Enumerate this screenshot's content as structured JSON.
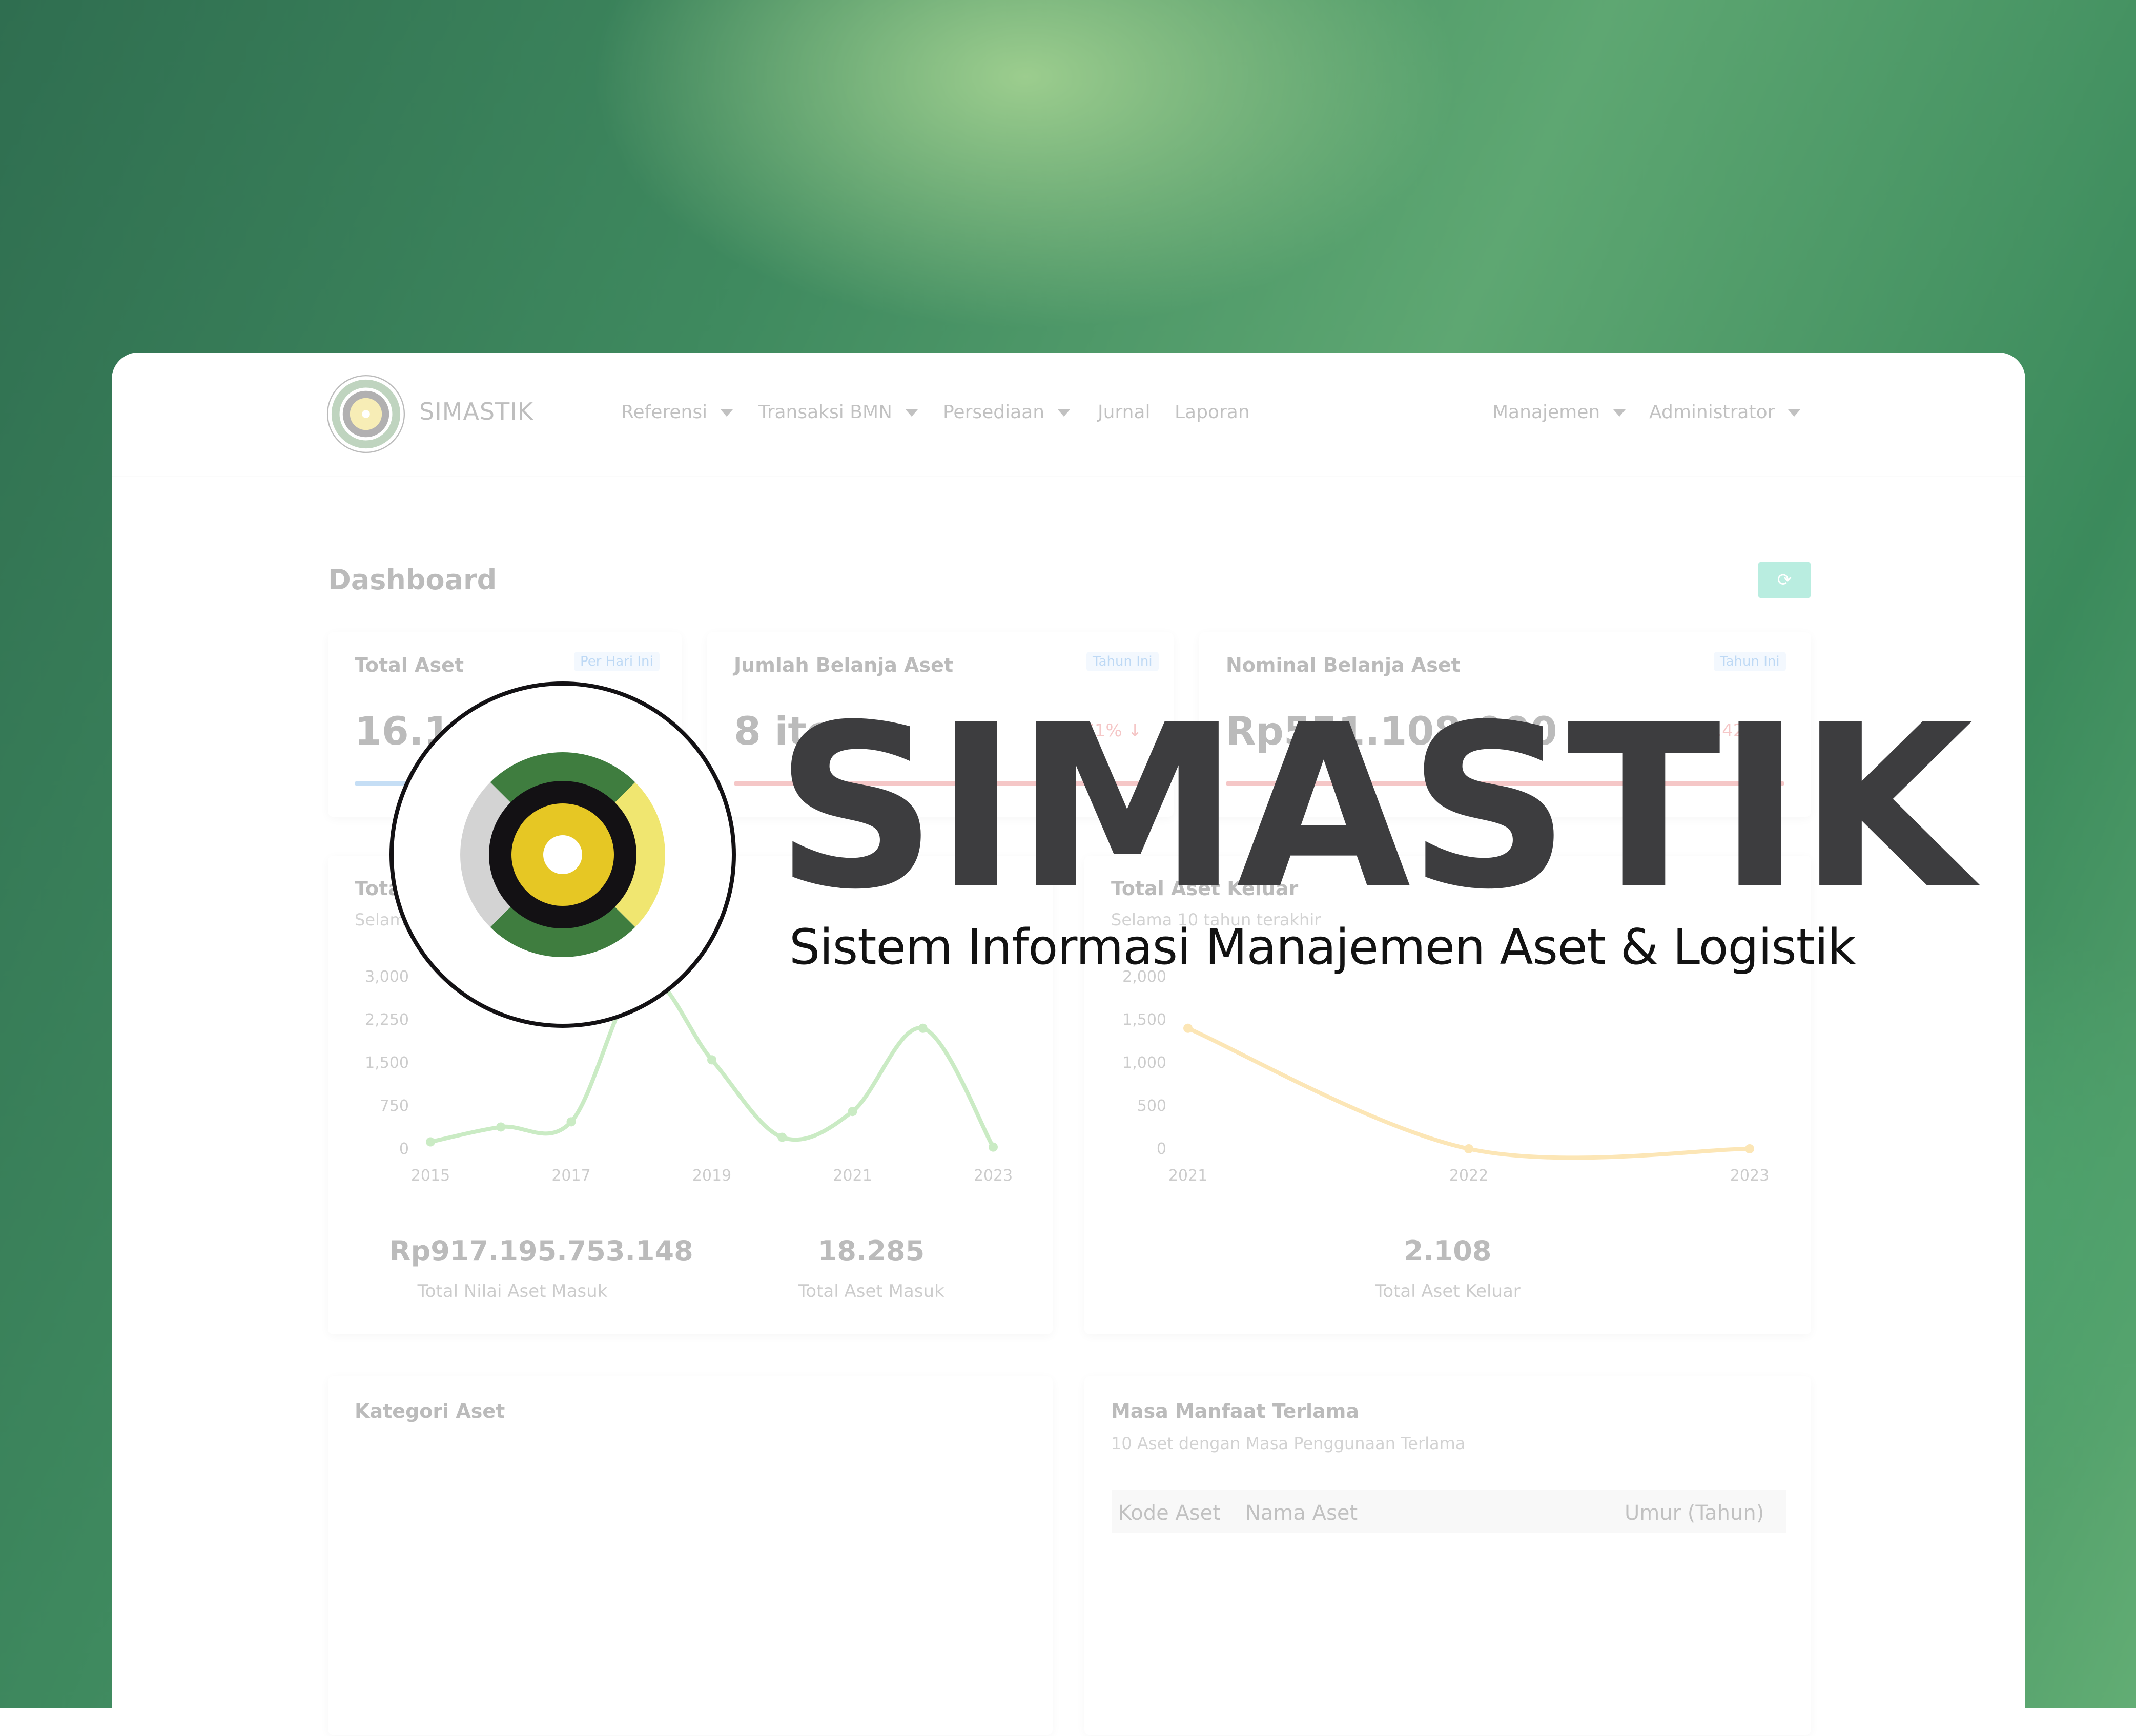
{
  "app": {
    "brand": "SIMASTIK",
    "tagline": "Sistem Informasi Manajemen Aset & Logistik"
  },
  "nav": {
    "items": [
      {
        "label": "Referensi",
        "dropdown": true
      },
      {
        "label": "Transaksi BMN",
        "dropdown": true
      },
      {
        "label": "Persediaan",
        "dropdown": true
      },
      {
        "label": "Jurnal",
        "dropdown": false
      },
      {
        "label": "Laporan",
        "dropdown": false
      }
    ],
    "right_items": [
      {
        "label": "Manajemen",
        "dropdown": true
      },
      {
        "label": "Administrator",
        "dropdown": true
      }
    ]
  },
  "page": {
    "title": "Dashboard",
    "refresh_icon": "refresh-icon"
  },
  "cards": [
    {
      "title": "Total Aset",
      "badge": "Per Hari Ini",
      "value": "16.1",
      "bar_color": "#4f9be0"
    },
    {
      "title": "Jumlah Belanja Aset",
      "badge": "Tahun Ini",
      "value": "8 item",
      "change": "99.61%",
      "trend": "down",
      "bar_color": "#e05555"
    },
    {
      "title": "Nominal Belanja Aset",
      "badge": "Tahun Ini",
      "value": "Rp551.108.000",
      "change": "98.42%",
      "trend": "down",
      "bar_color": "#e05555"
    }
  ],
  "panels": {
    "aset_masuk": {
      "title": "Tota",
      "subtitle": "Selam",
      "stats": [
        {
          "value": "Rp917.195.753.148",
          "label": "Total Nilai Aset Masuk"
        },
        {
          "value": "18.285",
          "label": "Total Aset Masuk"
        }
      ]
    },
    "aset_keluar": {
      "title": "Total Aset Keluar",
      "subtitle": "Selama 10 tahun terakhir",
      "stats": [
        {
          "value": "2.108",
          "label": "Total Aset Keluar"
        }
      ]
    },
    "kategori": {
      "title": "Kategori Aset"
    },
    "masa_manfaat": {
      "title": "Masa Manfaat Terlama",
      "subtitle": "10 Aset dengan Masa Penggunaan Terlama",
      "columns": [
        "Kode Aset",
        "Nama Aset",
        "Umur (Tahun)"
      ]
    }
  },
  "colors": {
    "accent": "#2cc9a0",
    "logo_green": "#3f7d3f",
    "logo_yellow": "#e6c724",
    "logo_light_yellow": "#f0e670",
    "logo_gray": "#d3d3d3",
    "logo_black": "#131114"
  },
  "chart_data": [
    {
      "type": "line",
      "x": [
        "2015",
        "2016",
        "2017",
        "2018",
        "2019",
        "2020",
        "2021",
        "2022",
        "2023"
      ],
      "series": [
        {
          "values": [
            120,
            380,
            470,
            3000,
            1550,
            200,
            650,
            2100,
            30
          ],
          "color": "#5fc24e"
        }
      ],
      "x_tick_labels": [
        "2015",
        "2017",
        "2019",
        "2021",
        "2023"
      ],
      "y_ticks": [
        "0",
        "750",
        "1,500",
        "2,250",
        "3,000"
      ],
      "ylim": [
        0,
        3000
      ]
    },
    {
      "type": "line",
      "x": [
        "2021",
        "2022",
        "2023"
      ],
      "series": [
        {
          "values": [
            1400,
            0,
            0
          ],
          "color": "#f5b324"
        }
      ],
      "x_tick_labels": [
        "2021",
        "2022",
        "2023"
      ],
      "y_ticks": [
        "0",
        "500",
        "1,000",
        "1,500",
        "2,000"
      ],
      "ylim": [
        0,
        2000
      ]
    }
  ]
}
